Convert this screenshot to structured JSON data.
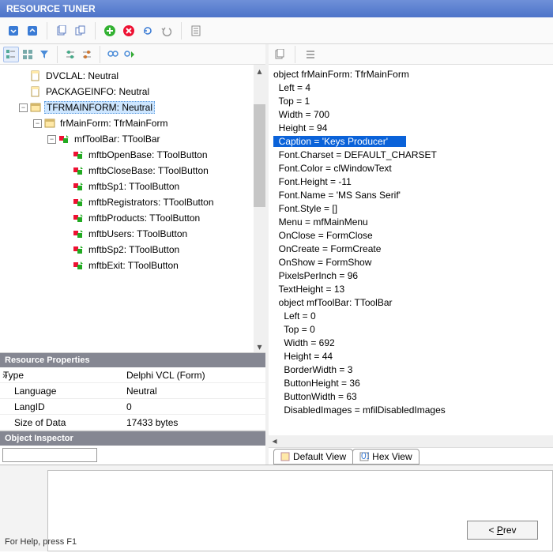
{
  "title": "RESOURCE TUNER",
  "toolbar_icons": [
    "arrow-down",
    "arrow-up",
    "copy",
    "copy2",
    "plus-green",
    "circle-x-red",
    "refresh-blue",
    "undo",
    "clipboard"
  ],
  "left_toolbar": {
    "view_icons": [
      "tree-view",
      "grid-view",
      "filter"
    ],
    "slider_icons": [
      "slider1",
      "slider2"
    ],
    "find_icons": [
      "binoculars",
      "play"
    ]
  },
  "tree": [
    {
      "level": 1,
      "exp": "",
      "icon": "file",
      "text": "DVCLAL: Neutral"
    },
    {
      "level": 1,
      "exp": "",
      "icon": "file",
      "text": "PACKAGEINFO: Neutral"
    },
    {
      "level": 1,
      "exp": "-",
      "icon": "form",
      "text": "TFRMAINFORM: Neutral",
      "selected": true
    },
    {
      "level": 2,
      "exp": "-",
      "icon": "form",
      "text": "frMainForm: TfrMainForm"
    },
    {
      "level": 3,
      "exp": "-",
      "icon": "comp",
      "text": "mfToolBar: TToolBar"
    },
    {
      "level": 4,
      "exp": "",
      "icon": "comp",
      "text": "mftbOpenBase: TToolButton"
    },
    {
      "level": 4,
      "exp": "",
      "icon": "comp",
      "text": "mftbCloseBase: TToolButton"
    },
    {
      "level": 4,
      "exp": "",
      "icon": "comp",
      "text": "mftbSp1: TToolButton"
    },
    {
      "level": 4,
      "exp": "",
      "icon": "comp",
      "text": "mftbRegistrators: TToolButton"
    },
    {
      "level": 4,
      "exp": "",
      "icon": "comp",
      "text": "mftbProducts: TToolButton"
    },
    {
      "level": 4,
      "exp": "",
      "icon": "comp",
      "text": "mftbUsers: TToolButton"
    },
    {
      "level": 4,
      "exp": "",
      "icon": "comp",
      "text": "mftbSp2: TToolButton"
    },
    {
      "level": 4,
      "exp": "",
      "icon": "comp",
      "text": "mftbExit: TToolButton"
    }
  ],
  "props_header": "Resource Properties",
  "props": [
    {
      "k": "Type",
      "v": "Delphi VCL (Form)"
    },
    {
      "k": "Language",
      "v": "Neutral"
    },
    {
      "k": "LangID",
      "v": "0"
    },
    {
      "k": "Size of Data",
      "v": "17433 bytes"
    }
  ],
  "inspector_header": "Object Inspector",
  "code": [
    "object frMainForm: TfrMainForm",
    "  Left = 4",
    "  Top = 1",
    "  Width = 700",
    "  Height = 94",
    "  Caption = 'Keys Producer'",
    "  Font.Charset = DEFAULT_CHARSET",
    "  Font.Color = clWindowText",
    "  Font.Height = -11",
    "  Font.Name = 'MS Sans Serif'",
    "  Font.Style = []",
    "  Menu = mfMainMenu",
    "  OnClose = FormClose",
    "  OnCreate = FormCreate",
    "  OnShow = FormShow",
    "  PixelsPerInch = 96",
    "  TextHeight = 13",
    "  object mfToolBar: TToolBar",
    "    Left = 0",
    "    Top = 0",
    "    Width = 692",
    "    Height = 44",
    "    BorderWidth = 3",
    "    ButtonHeight = 36",
    "    ButtonWidth = 63",
    "    DisabledImages = mfilDisabledImages"
  ],
  "highlighted_line_index": 5,
  "tabs": [
    {
      "icon": "form",
      "label": "Default View"
    },
    {
      "icon": "hex",
      "label": "Hex View"
    }
  ],
  "prev_button": "< Prev",
  "status_text": "For Help, press F1"
}
